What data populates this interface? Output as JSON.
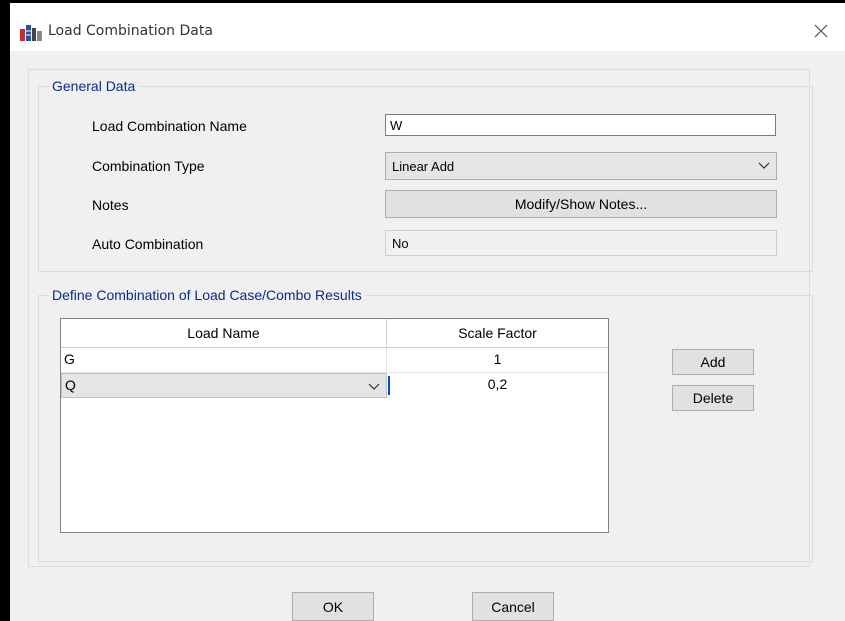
{
  "window": {
    "title": "Load Combination Data",
    "app_icon": "etabs-icon",
    "close_icon": "close-icon"
  },
  "general": {
    "legend": "General Data",
    "name_label": "Load Combination Name",
    "name_value": "W",
    "type_label": "Combination Type",
    "type_value": "Linear Add",
    "notes_label": "Notes",
    "notes_button": "Modify/Show Notes...",
    "auto_label": "Auto Combination",
    "auto_value": "No"
  },
  "define": {
    "legend": "Define Combination of Load Case/Combo Results",
    "columns": [
      "Load Name",
      "Scale Factor"
    ],
    "rows": [
      {
        "name": "G",
        "scale": "1"
      },
      {
        "name": "Q",
        "scale": "0,2"
      }
    ],
    "add_button": "Add",
    "delete_button": "Delete"
  },
  "footer": {
    "ok": "OK",
    "cancel": "Cancel"
  }
}
